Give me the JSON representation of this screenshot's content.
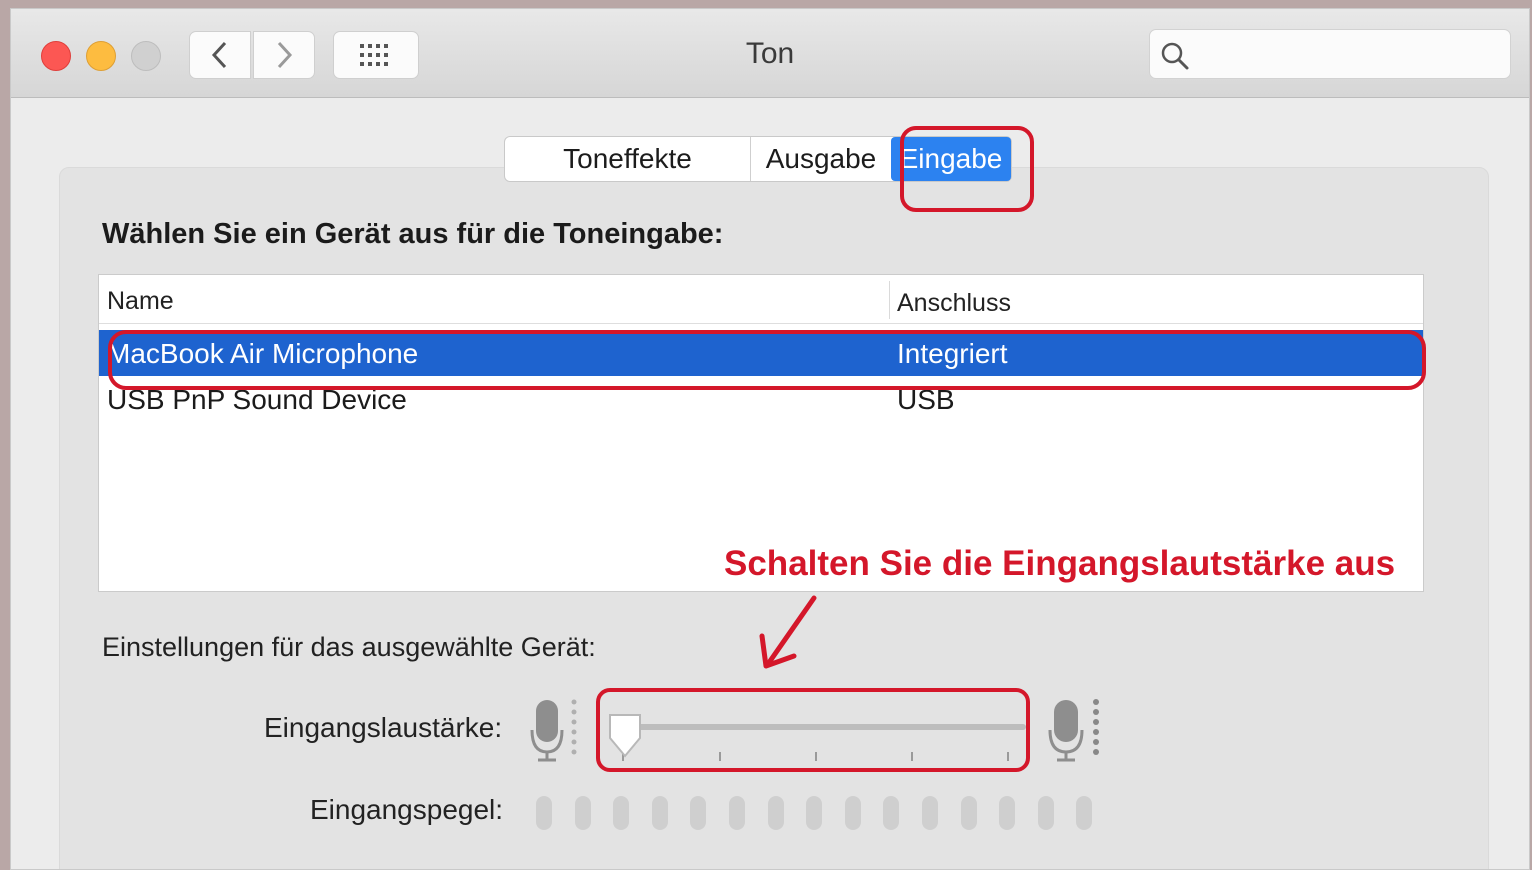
{
  "window": {
    "title": "Ton",
    "search": {
      "placeholder": ""
    }
  },
  "toolbar": {
    "back_icon": "chevron-left-icon",
    "forward_icon": "chevron-right-icon",
    "grid_icon": "grid-icon",
    "search_icon": "search-icon"
  },
  "tabs": [
    {
      "label": "Toneffekte",
      "selected": false
    },
    {
      "label": "Ausgabe",
      "selected": false
    },
    {
      "label": "Eingabe",
      "selected": true
    }
  ],
  "device_section": {
    "heading": "Wählen Sie ein Gerät aus für die Toneingabe:",
    "columns": [
      "Name",
      "Anschluss"
    ],
    "rows": [
      {
        "name": "MacBook Air Microphone",
        "connection": "Integriert",
        "selected": true
      },
      {
        "name": "USB PnP Sound Device",
        "connection": "USB",
        "selected": false
      }
    ]
  },
  "annotation": {
    "text": "Schalten Sie die Eingangslautstärke aus",
    "color": "#d4172a"
  },
  "settings": {
    "heading": "Einstellungen für das ausgewählte Gerät:",
    "input_volume_label": "Eingangslaustärke:",
    "input_volume_value": 0,
    "input_level_label": "Eingangspegel:",
    "input_level_segments": 15,
    "input_level_active": 0
  },
  "colors": {
    "accent": "#2c82f0",
    "selection": "#1e63cf",
    "highlight": "#d4172a"
  }
}
